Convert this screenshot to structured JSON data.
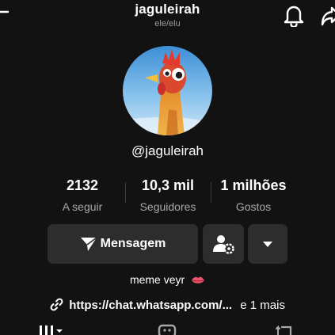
{
  "header": {
    "username": "jaguleirah",
    "pronouns": "ele/elu",
    "icons": [
      "back-icon",
      "bell-icon",
      "share-icon"
    ]
  },
  "profile": {
    "handle": "@jaguleirah",
    "avatar": "rooster-avatar",
    "bio": "meme veyr",
    "bio_icon": "lips-icon",
    "link": "https://chat.whatsapp.com/...",
    "link_more": "e 1 mais"
  },
  "stats": [
    {
      "value": "2132",
      "label": "A seguir"
    },
    {
      "value": "10,3 mil",
      "label": "Seguidores"
    },
    {
      "value": "1 milhões",
      "label": "Gostos"
    }
  ],
  "actions": {
    "message_label": "Mensagem",
    "icons": [
      "send-icon",
      "add-friend-settings-icon",
      "dropdown-arrow-icon"
    ]
  },
  "tabs": {
    "icons": [
      "grid-tab-icon",
      "chat-tab-icon",
      "repost-tab-icon"
    ]
  },
  "colors": {
    "background": "#121212",
    "button": "#2d2d2d",
    "secondary_text": "#a8a8a8"
  }
}
